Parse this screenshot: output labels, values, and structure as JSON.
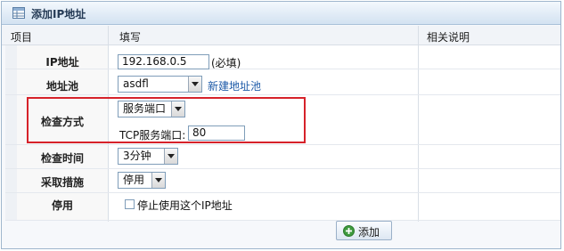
{
  "panel": {
    "title": "添加IP地址"
  },
  "columns": {
    "item": "项目",
    "fill": "填写",
    "notes": "相关说明"
  },
  "rows": {
    "ip": {
      "label": "IP地址",
      "value": "192.168.0.5",
      "hint": "(必填)"
    },
    "pool": {
      "label": "地址池",
      "value": "asdfl",
      "link": "新建地址池"
    },
    "check_method": {
      "label": "检查方式",
      "value": "服务端口",
      "port_label": "TCP服务端口:",
      "port_value": "80"
    },
    "check_time": {
      "label": "检查时间",
      "value": "3分钟"
    },
    "action": {
      "label": "采取措施",
      "value": "停用"
    },
    "disable": {
      "label": "停用",
      "checkbox_label": "停止使用这个IP地址",
      "checked": false
    }
  },
  "footer": {
    "add_label": "添加"
  },
  "colors": {
    "highlight_border": "#d6222a",
    "link": "#1d5aa8",
    "title_bg": "#d3e2f1"
  }
}
